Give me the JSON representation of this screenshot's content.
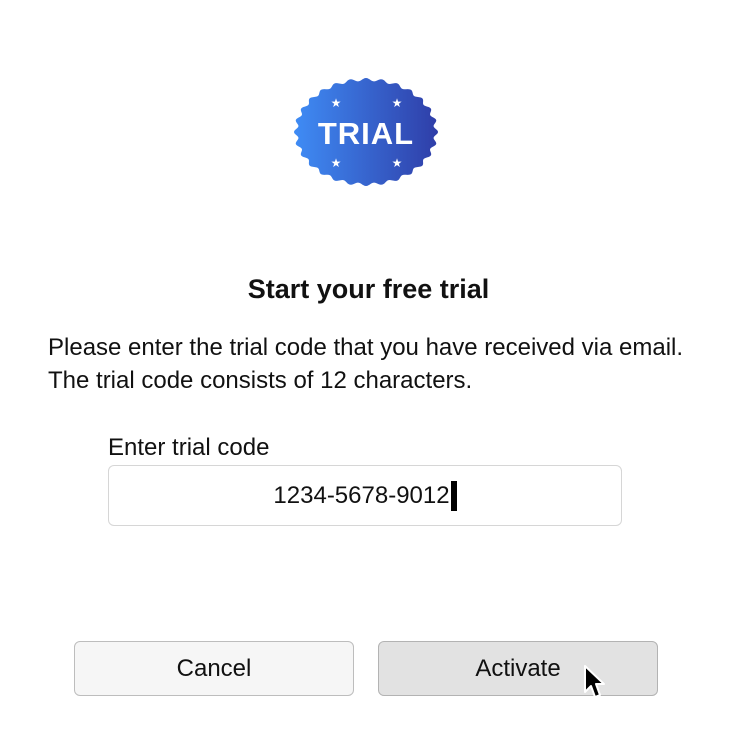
{
  "badge": {
    "text": "TRIAL",
    "gradient_start": "#3f8cf5",
    "gradient_end": "#2f3ea8",
    "star_color": "#ffffff"
  },
  "title": "Start your free trial",
  "description": "Please enter the trial code that you have received via email. The trial code consists of 12 characters.",
  "code_field": {
    "label": "Enter trial code",
    "value": "1234-5678-9012"
  },
  "buttons": {
    "cancel_label": "Cancel",
    "activate_label": "Activate"
  }
}
